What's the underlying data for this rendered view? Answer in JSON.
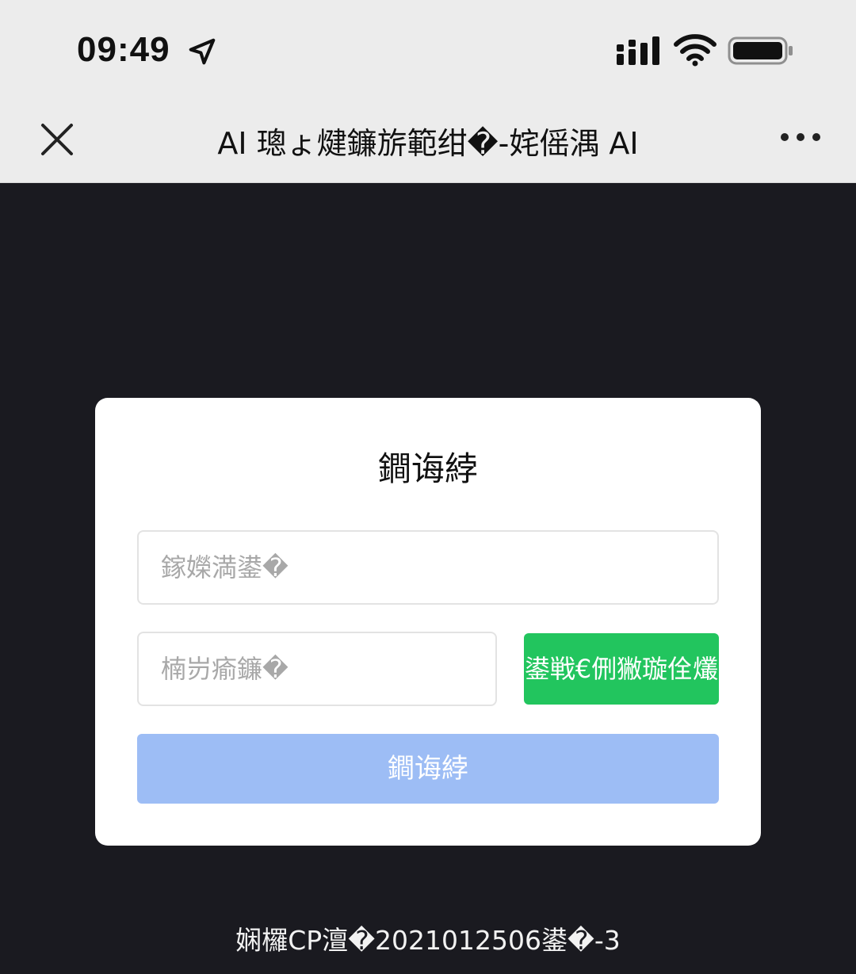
{
  "status_bar": {
    "time": "09:49",
    "icons": [
      "location-arrow-icon",
      "cellular-signal-icon",
      "wifi-icon",
      "battery-icon"
    ]
  },
  "nav": {
    "title": "AI 璁ょ煡鐮旂範绀�-姹傜湡 AI",
    "left_icon": "close-icon",
    "right_icon": "more-icon"
  },
  "login_card": {
    "title": "鐧诲綍",
    "phone_placeholder": "鎵嬫満鍙�",
    "code_placeholder": "楠岃瘉鐮�",
    "send_code_label": "鍙戦€侀獙璇佺爜",
    "login_label": "鐧诲綍"
  },
  "footer": {
    "icp_text": "娴欏CP澶�2021012506鍙�-3"
  },
  "colors": {
    "background": "#1a1a20",
    "bars": "#ececec",
    "send_code_button": "#22c55e",
    "login_button": "#9dbdf5"
  }
}
